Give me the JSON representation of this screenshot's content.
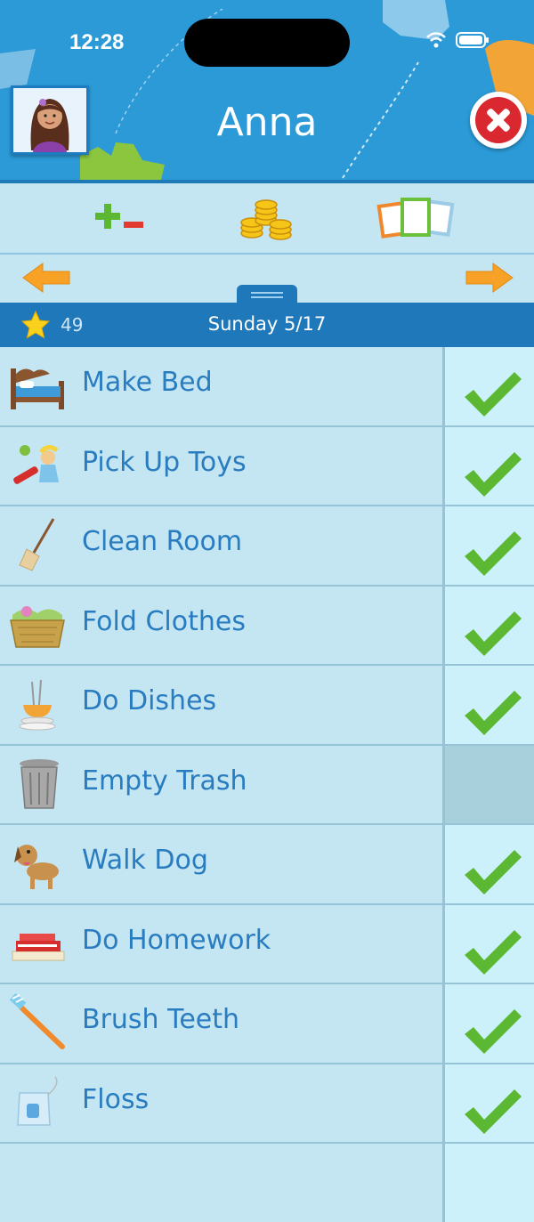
{
  "status_bar": {
    "time": "12:28"
  },
  "header": {
    "child_name": "Anna"
  },
  "toolbar": {
    "items": [
      {
        "icon": "plus-minus-icon"
      },
      {
        "icon": "coins-icon"
      },
      {
        "icon": "photo-cards-icon"
      }
    ]
  },
  "date_bar": {
    "points": "49",
    "date": "Sunday 5/17"
  },
  "chores": [
    {
      "label": "Make Bed",
      "icon": "bed-icon",
      "done": true
    },
    {
      "label": "Pick Up Toys",
      "icon": "toys-icon",
      "done": true
    },
    {
      "label": "Clean Room",
      "icon": "broom-icon",
      "done": true
    },
    {
      "label": "Fold Clothes",
      "icon": "laundry-basket-icon",
      "done": true
    },
    {
      "label": "Do Dishes",
      "icon": "dishes-icon",
      "done": true
    },
    {
      "label": "Empty Trash",
      "icon": "trash-can-icon",
      "done": false
    },
    {
      "label": "Walk Dog",
      "icon": "dog-icon",
      "done": true
    },
    {
      "label": "Do Homework",
      "icon": "books-icon",
      "done": true
    },
    {
      "label": "Brush Teeth",
      "icon": "toothbrush-icon",
      "done": true
    },
    {
      "label": "Floss",
      "icon": "floss-icon",
      "done": true
    }
  ],
  "colors": {
    "header": "#2b9ad6",
    "datebar": "#1f78ba",
    "row": "#c3e6f2",
    "check": "#5cb832",
    "label": "#2a7cc0"
  }
}
